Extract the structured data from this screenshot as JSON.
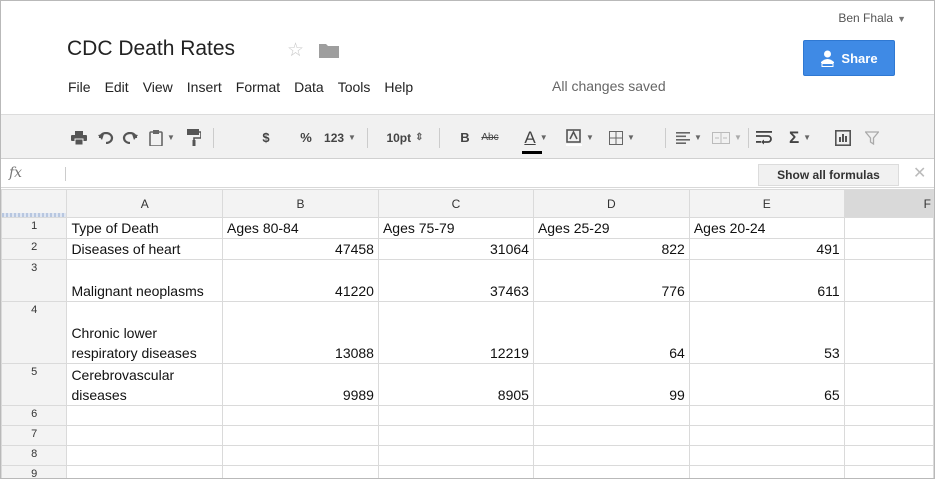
{
  "app": {
    "user_name": "Ben Fhala",
    "doc_title": "CDC Death Rates",
    "share_label": "Share",
    "save_status": "All changes saved",
    "menu": [
      "File",
      "Edit",
      "View",
      "Insert",
      "Format",
      "Data",
      "Tools",
      "Help"
    ]
  },
  "toolbar": {
    "currency": "$",
    "percent": "%",
    "number_format": "123",
    "font_size": "10pt",
    "bold": "B",
    "strikethrough": "Abc",
    "text_color": "A",
    "sum": "Σ"
  },
  "formula_bar": {
    "fx_label": "fx",
    "show_formulas_label": "Show all formulas"
  },
  "grid": {
    "columns": [
      "A",
      "B",
      "C",
      "D",
      "E",
      "F"
    ],
    "rows": [
      {
        "num": "1",
        "cells": [
          "Type of Death",
          "Ages 80-84",
          "Ages 75-79",
          "Ages 25-29",
          "Ages 20-24",
          ""
        ]
      },
      {
        "num": "2",
        "cells": [
          "Diseases of heart",
          "47458",
          "31064",
          "822",
          "491",
          ""
        ]
      },
      {
        "num": "3",
        "cells": [
          "Malignant neoplasms",
          "41220",
          "37463",
          "776",
          "611",
          ""
        ]
      },
      {
        "num": "4",
        "cells": [
          "Chronic lower respiratory diseases",
          "13088",
          "12219",
          "64",
          "53",
          ""
        ]
      },
      {
        "num": "5",
        "cells": [
          "Cerebrovascular diseases",
          "9989",
          "8905",
          "99",
          "65",
          ""
        ]
      },
      {
        "num": "6",
        "cells": [
          "",
          "",
          "",
          "",
          "",
          ""
        ]
      },
      {
        "num": "7",
        "cells": [
          "",
          "",
          "",
          "",
          "",
          ""
        ]
      },
      {
        "num": "8",
        "cells": [
          "",
          "",
          "",
          "",
          "",
          ""
        ]
      },
      {
        "num": "9",
        "cells": [
          "",
          "",
          "",
          "",
          "",
          ""
        ]
      }
    ]
  },
  "colors": {
    "share_button": "#3f8ae5",
    "toolbar_bg": "#f1f1f1",
    "header_bg": "#f3f3f3",
    "selected_column_header": "#d9d9d9"
  }
}
